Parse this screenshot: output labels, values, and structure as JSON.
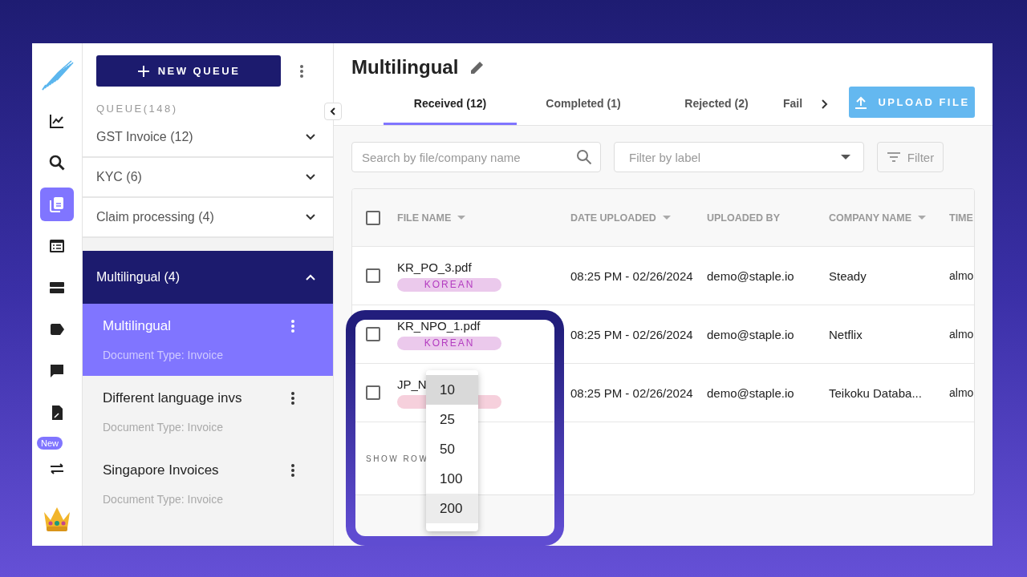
{
  "rail": {
    "items": [
      {
        "kind": "chart",
        "selected": false
      },
      {
        "kind": "search",
        "selected": false
      },
      {
        "kind": "documents",
        "selected": true
      },
      {
        "kind": "table",
        "selected": false
      },
      {
        "kind": "rows",
        "selected": false
      },
      {
        "kind": "tag",
        "selected": false
      },
      {
        "kind": "comment",
        "selected": false
      },
      {
        "kind": "doc-edit",
        "selected": false
      },
      {
        "kind": "transfer",
        "selected": false,
        "badge": "New"
      }
    ]
  },
  "queue_panel": {
    "new_button": "NEW QUEUE",
    "section_label": "QUEUE(148)",
    "queues": [
      {
        "label": "GST Invoice (12)",
        "expanded": false
      },
      {
        "label": "KYC (6)",
        "expanded": false
      },
      {
        "label": "Claim processing (4)",
        "expanded": false
      },
      {
        "label": "Multilingual (4)",
        "expanded": true,
        "children": [
          {
            "title": "Multilingual",
            "subtitle": "Document Type: Invoice",
            "selected": true
          },
          {
            "title": "Different language invs",
            "subtitle": "Document Type: Invoice",
            "selected": false
          },
          {
            "title": "Singapore Invoices",
            "subtitle": "Document Type: Invoice",
            "selected": false
          }
        ]
      }
    ]
  },
  "main": {
    "title": "Multilingual",
    "tabs": [
      {
        "label": "Received (12)",
        "selected": true
      },
      {
        "label": "Completed (1)",
        "selected": false
      },
      {
        "label": "Rejected (2)",
        "selected": false
      },
      {
        "label": "Fail",
        "selected": false
      }
    ],
    "upload_button": "UPLOAD FILE",
    "search": {
      "placeholder": "Search by file/company name"
    },
    "label_filter": {
      "placeholder": "Filter by label"
    },
    "filter_button": "Filter",
    "table": {
      "all_checked": false,
      "columns": [
        {
          "label": "FILE NAME",
          "sortable": true
        },
        {
          "label": "DATE UPLOADED",
          "sortable": true
        },
        {
          "label": "UPLOADED BY",
          "sortable": false
        },
        {
          "label": "COMPANY NAME",
          "sortable": true
        },
        {
          "label": "TIME",
          "sortable": false
        }
      ],
      "rows": [
        {
          "checked": false,
          "file_name": "KR_PO_3.pdf",
          "tag": {
            "label": "KOREAN",
            "color": "#ebc9ec"
          },
          "date": "08:25 PM - 02/26/2024",
          "uploaded_by": "demo@staple.io",
          "company": "Steady",
          "column_5": "almo"
        },
        {
          "checked": false,
          "file_name": "KR_NPO_1.pdf",
          "tag": {
            "label": "KOREAN",
            "color": "#ebc9ec"
          },
          "date": "08:25 PM - 02/26/2024",
          "uploaded_by": "demo@staple.io",
          "company": "Netflix",
          "column_5": "almo"
        },
        {
          "checked": false,
          "file_name": "JP_N",
          "tag": {
            "color": "#f6d0dc"
          },
          "date": "08:25 PM - 02/26/2024",
          "uploaded_by": "demo@staple.io",
          "company": "Teikoku Databa...",
          "column_5": "almo"
        }
      ],
      "footer_label": "SHOW ROW"
    },
    "rows_menu": {
      "options": [
        {
          "label": "10",
          "selected": true,
          "hovered": false
        },
        {
          "label": "25",
          "selected": false,
          "hovered": false
        },
        {
          "label": "50",
          "selected": false,
          "hovered": false
        },
        {
          "label": "100",
          "selected": false,
          "hovered": false
        },
        {
          "label": "200",
          "selected": false,
          "hovered": true
        }
      ]
    }
  }
}
